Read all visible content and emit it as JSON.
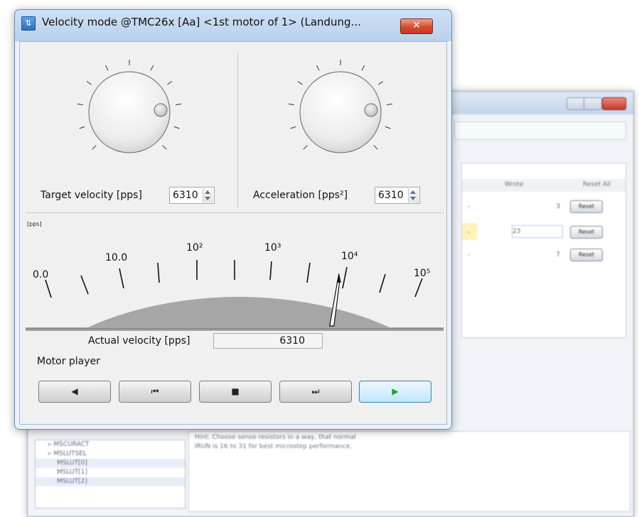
{
  "background_window": {
    "tree_items": [
      "MSCURACT",
      "MSLUTSEL",
      "MSLUT[0]",
      "MSLUT[1]",
      "MSLUT[2]"
    ],
    "description_lines": [
      "Hint: Choose sense resistors in a way, that normal",
      "IRUN is 16 to 31 for best microstep performance."
    ],
    "grid": {
      "headers": [
        "Wrote",
        "Reset All"
      ],
      "rows": [
        {
          "dash": "-",
          "value": "3",
          "reset": "Reset"
        },
        {
          "dash": "-",
          "value": "23",
          "reset": "Reset"
        },
        {
          "dash": "-",
          "value": "7",
          "reset": "Reset"
        }
      ]
    }
  },
  "dialog": {
    "title": "Velocity mode @TMC26x [Aa] <1st motor of 1> (Landung...",
    "close_label": "✕",
    "icon": "sliders-icon",
    "target": {
      "label": "Target velocity [pps]",
      "value": "6310"
    },
    "acceleration": {
      "label": "Acceleration [pps²]",
      "value": "6310"
    },
    "gauge": {
      "unit": "[pps]",
      "scale": "log",
      "labels": [
        "0.0",
        "10.0",
        "10²",
        "10³",
        "10⁴",
        "10⁵"
      ],
      "needle_value": 6310,
      "min": 0,
      "max": 100000
    },
    "actual": {
      "label": "Actual velocity [pps]",
      "value": "6310"
    },
    "player": {
      "label": "Motor player",
      "buttons": [
        {
          "name": "rewind",
          "glyph": "◀"
        },
        {
          "name": "previous",
          "glyph": "⏮"
        },
        {
          "name": "stop",
          "glyph": "■"
        },
        {
          "name": "next",
          "glyph": "⏭"
        },
        {
          "name": "play",
          "glyph": "▶"
        }
      ]
    }
  }
}
